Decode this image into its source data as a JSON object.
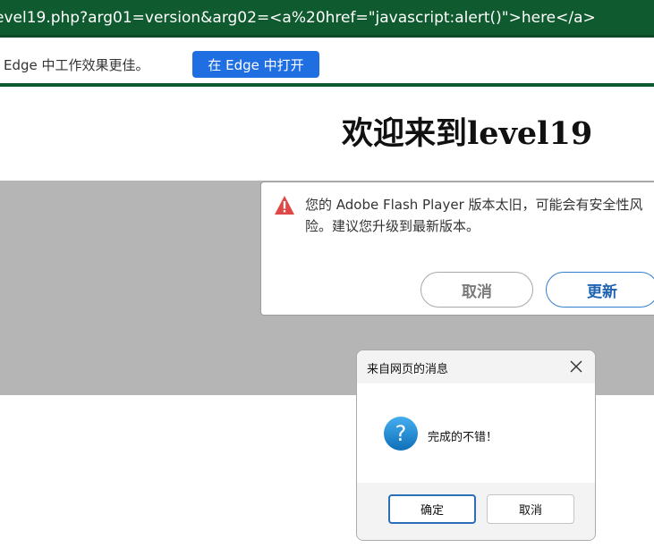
{
  "address_bar": {
    "url": "evel19.php?arg01=version&arg02=<a%20href=\"javascript:alert()\">here</a>"
  },
  "edge_banner": {
    "message": "Edge 中工作效果更佳。",
    "open_button_label": "在 Edge 中打开"
  },
  "page": {
    "title": "欢迎来到level19"
  },
  "flash_popup": {
    "message": "您的 Adobe Flash Player 版本太旧，可能会有安全性风险。建议您升级到最新版本。",
    "cancel_label": "取消",
    "update_label": "更新"
  },
  "alert_dialog": {
    "title": "来自网页的消息",
    "message": "完成的不错！",
    "ok_label": "确定",
    "cancel_label": "取消"
  },
  "icons": {
    "warning": "warning-icon",
    "close": "close-icon",
    "question": "question-icon"
  },
  "colors": {
    "address_bar": "#0f5a2e",
    "edge_button": "#1f6fe3",
    "flash_area": "#b5b5b5",
    "warning": "#e04848",
    "question": "#1a8ad4",
    "update_button": "#1f64b3"
  }
}
